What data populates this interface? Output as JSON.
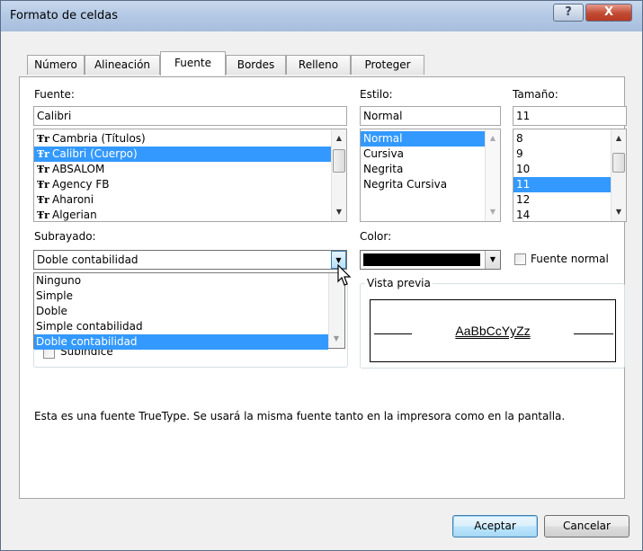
{
  "window": {
    "title": "Formato de celdas",
    "help_glyph": "?",
    "close_glyph": "X"
  },
  "tabs": [
    {
      "label": "Número"
    },
    {
      "label": "Alineación"
    },
    {
      "label": "Fuente"
    },
    {
      "label": "Bordes"
    },
    {
      "label": "Relleno"
    },
    {
      "label": "Proteger"
    }
  ],
  "active_tab": "Fuente",
  "font": {
    "label": "Fuente:",
    "value": "Calibri",
    "items": [
      {
        "label": "Cambria (Títulos)"
      },
      {
        "label": "Calibri (Cuerpo)"
      },
      {
        "label": "ABSALOM"
      },
      {
        "label": "Agency FB"
      },
      {
        "label": "Aharoni"
      },
      {
        "label": "Algerian"
      }
    ],
    "selected": "Calibri (Cuerpo)"
  },
  "style": {
    "label": "Estilo:",
    "value": "Normal",
    "items": [
      {
        "label": "Normal"
      },
      {
        "label": "Cursiva"
      },
      {
        "label": "Negrita"
      },
      {
        "label": "Negrita Cursiva"
      }
    ],
    "selected": "Normal"
  },
  "size": {
    "label": "Tamaño:",
    "value": "11",
    "items": [
      {
        "label": "8"
      },
      {
        "label": "9"
      },
      {
        "label": "10"
      },
      {
        "label": "11"
      },
      {
        "label": "12"
      },
      {
        "label": "14"
      }
    ],
    "selected": "11"
  },
  "underline": {
    "label": "Subrayado:",
    "value": "Doble contabilidad",
    "options": [
      {
        "label": "Ninguno"
      },
      {
        "label": "Simple"
      },
      {
        "label": "Doble"
      },
      {
        "label": "Simple contabilidad"
      },
      {
        "label": "Doble contabilidad"
      }
    ],
    "selected": "Doble contabilidad"
  },
  "color": {
    "label": "Color:",
    "value": "#000000"
  },
  "normal_font": {
    "label": "Fuente normal",
    "checked": false
  },
  "effects": {
    "subscript_label": "Subíndice",
    "subscript_checked": false
  },
  "preview": {
    "title": "Vista previa",
    "sample": "AaBbCcYyZz"
  },
  "description": "Esta es una fuente TrueType. Se usará la misma fuente tanto en la impresora como en la pantalla.",
  "buttons": {
    "ok": "Aceptar",
    "cancel": "Cancelar"
  },
  "icons": {
    "truetype": "TrueType-font-icon",
    "scroll_up": "▲",
    "scroll_down": "▼",
    "dropdown": "▼"
  }
}
